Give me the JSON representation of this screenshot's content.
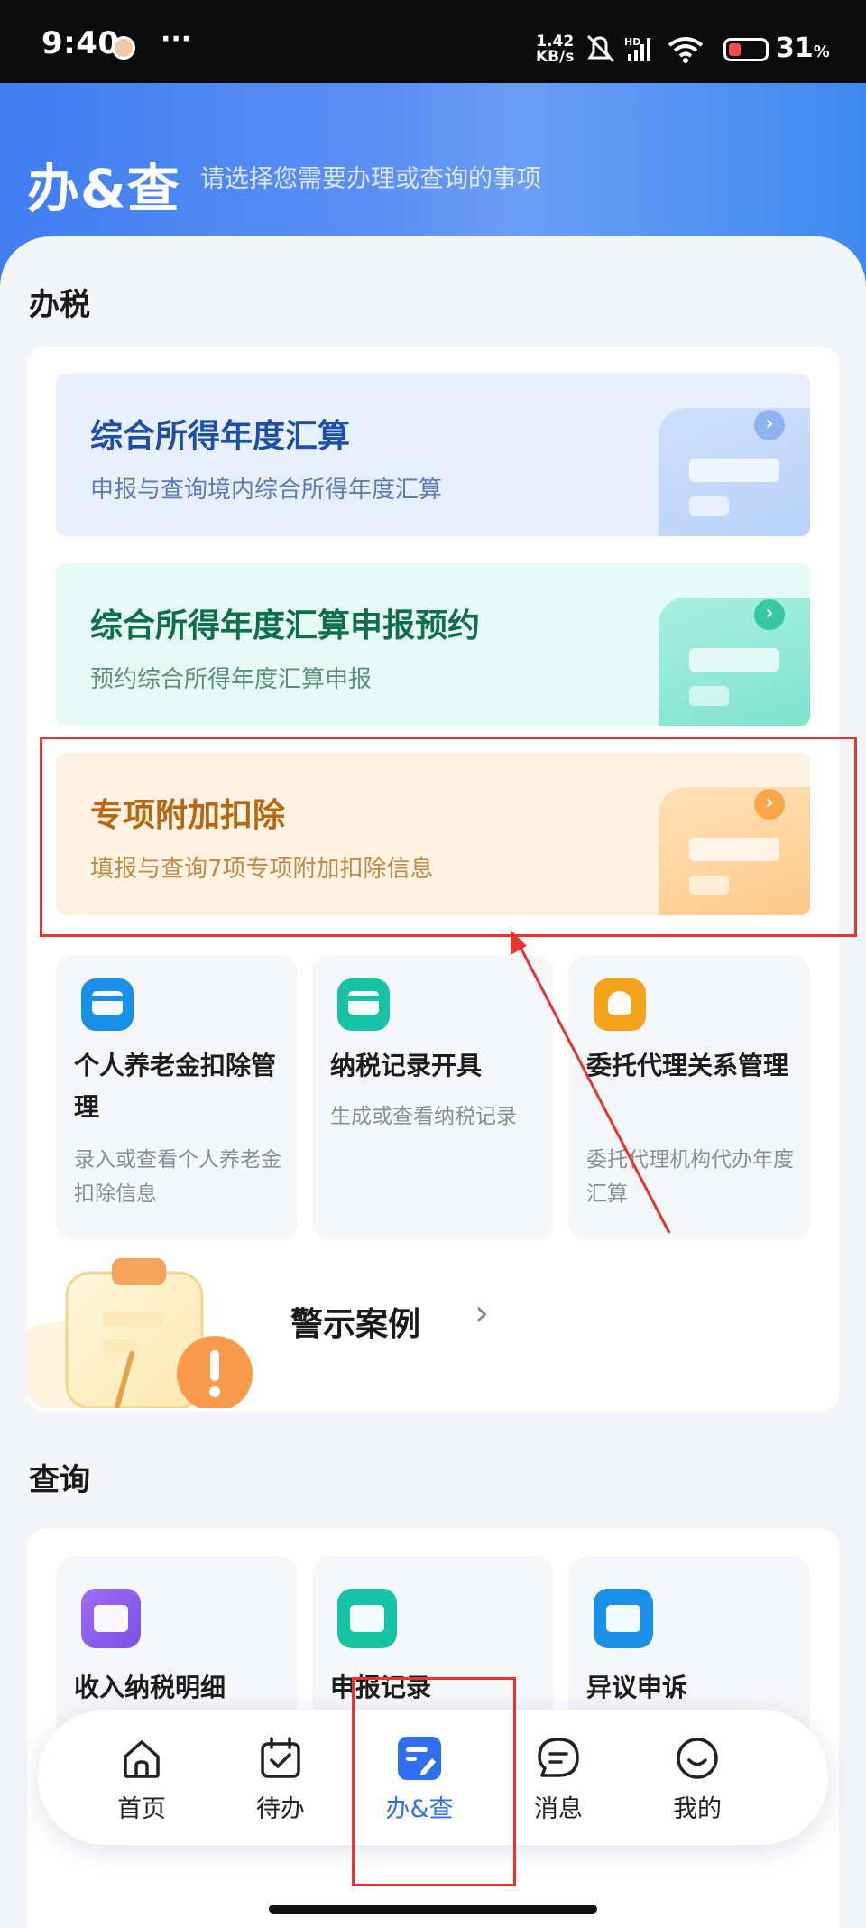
{
  "status_bar": {
    "time": "9:40",
    "more": "···",
    "net_speed_top": "1.42",
    "net_speed_bottom": "KB/s",
    "battery_pct": "31",
    "battery_unit": "%"
  },
  "header": {
    "title": "办&查",
    "subtitle": "请选择您需要办理或查询的事项"
  },
  "tax_section": {
    "title": "办税",
    "big_cards": [
      {
        "title": "综合所得年度汇算",
        "subtitle": "申报与查询境内综合所得年度汇算",
        "title_color": "#1e4fa8",
        "sub_color": "#5a7bb4",
        "bg": "#e7effd"
      },
      {
        "title": "综合所得年度汇算申报预约",
        "subtitle": "预约综合所得年度汇算申报",
        "title_color": "#0f6e4e",
        "sub_color": "#5a8f7e",
        "bg": "#e6faf6"
      },
      {
        "title": "专项附加扣除",
        "subtitle": "填报与查询7项专项附加扣除信息",
        "title_color": "#b8670e",
        "sub_color": "#c08a45",
        "bg": "#fef3e3"
      }
    ],
    "small_cards": [
      {
        "title": "个人养老金扣除管理",
        "subtitle": "录入或查看个人养老金扣除信息",
        "icon": "pension-card-icon"
      },
      {
        "title": "纳税记录开具",
        "subtitle": "生成或查看纳税记录",
        "icon": "tax-record-icon"
      },
      {
        "title": "委托代理关系管理",
        "subtitle": "委托代理机构代办年度汇算",
        "icon": "agent-relation-icon"
      }
    ],
    "warning": {
      "label": "警示案例",
      "chevron": "›"
    }
  },
  "query_section": {
    "title": "查询",
    "cards": [
      {
        "title": "收入纳税明细",
        "icon": "income-tax-detail-icon"
      },
      {
        "title": "申报记录",
        "icon": "declaration-record-icon"
      },
      {
        "title": "异议申诉",
        "icon": "appeal-icon"
      }
    ]
  },
  "bottom_nav": {
    "items": [
      {
        "label": "首页",
        "icon": "home-icon"
      },
      {
        "label": "待办",
        "icon": "todo-calendar-icon"
      },
      {
        "label": "办&查",
        "icon": "handle-query-icon",
        "active": true
      },
      {
        "label": "消息",
        "icon": "message-icon"
      },
      {
        "label": "我的",
        "icon": "profile-smile-icon"
      }
    ]
  },
  "colors": {
    "accent": "#2f6ff0",
    "header_blue": "#4f86f2",
    "annotation_red": "#e8332e"
  }
}
